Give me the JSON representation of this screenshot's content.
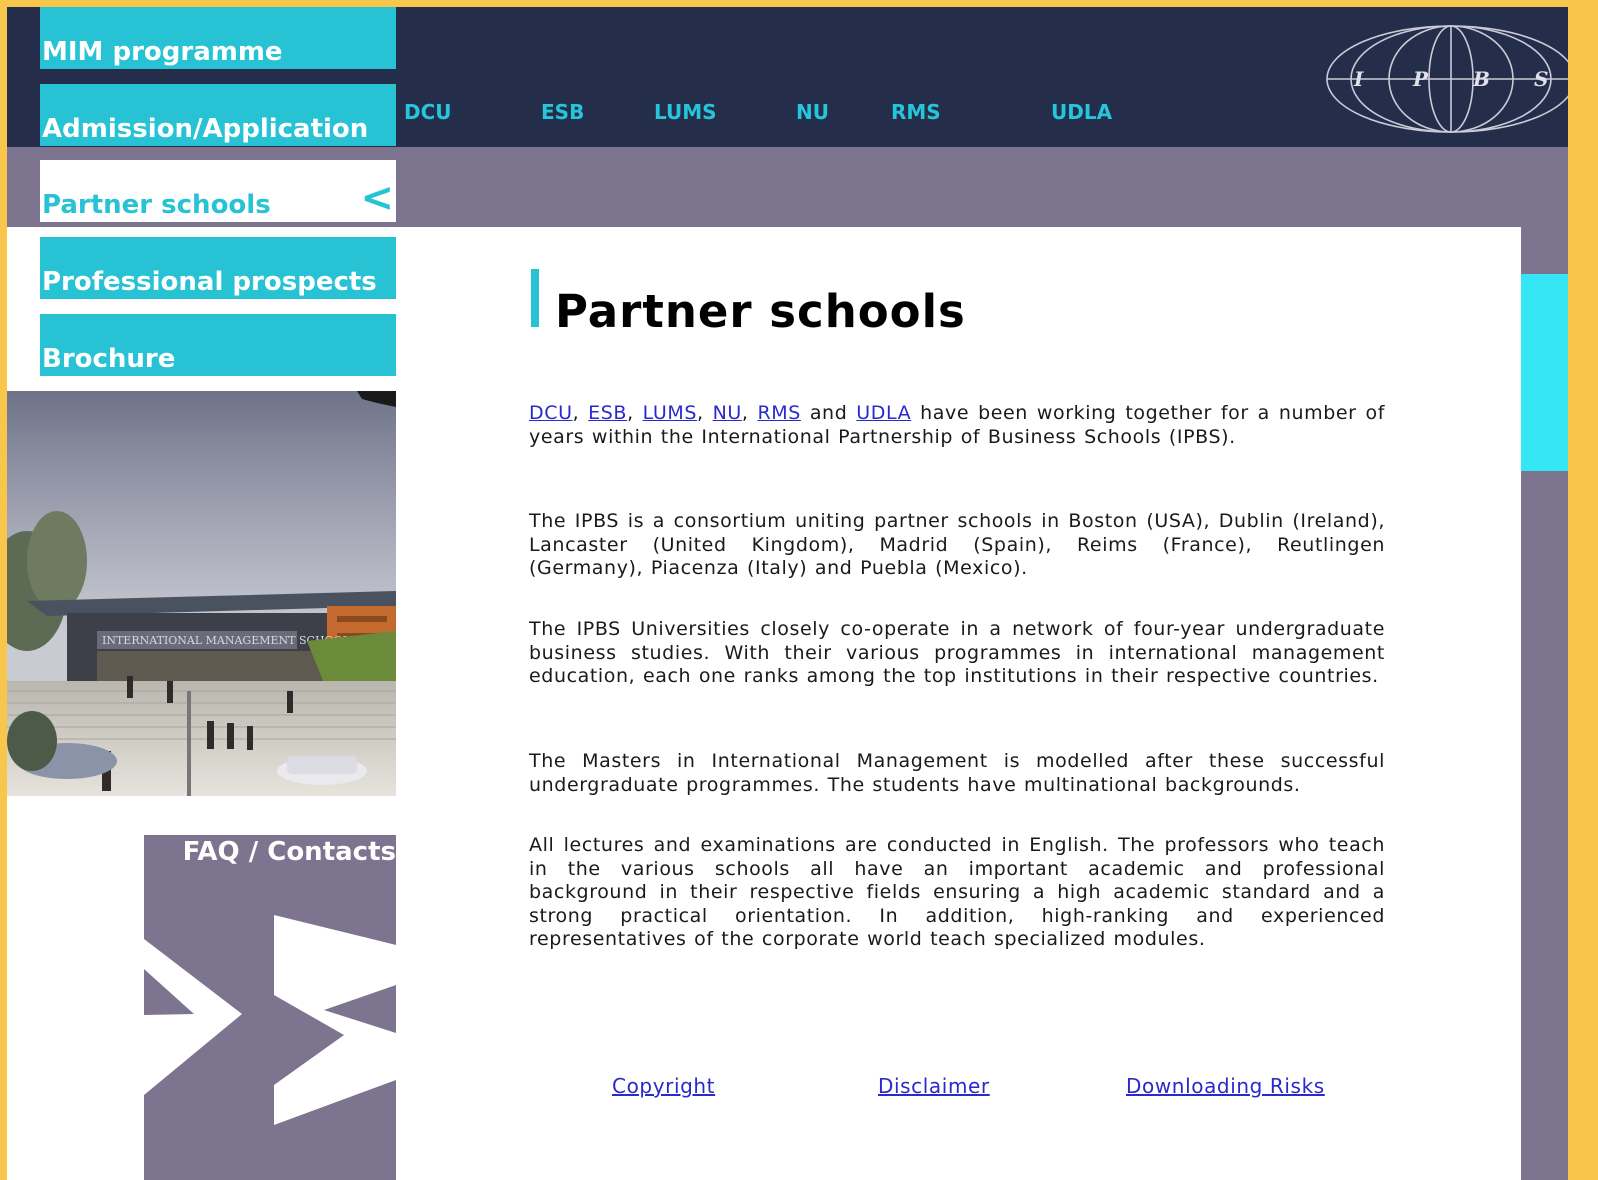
{
  "sidebar": {
    "items": [
      {
        "label": "MIM programme"
      },
      {
        "label": "Admission/Application"
      },
      {
        "label": "Partner schools",
        "active_indicator": "<"
      },
      {
        "label": "Professional prospects"
      },
      {
        "label": "Brochure"
      }
    ],
    "faq_label": "FAQ / Contacts",
    "campus_image_caption": "INTERNATIONAL MANAGEMENT SCHOOL"
  },
  "topnav": {
    "items": [
      {
        "label": "DCU"
      },
      {
        "label": "ESB"
      },
      {
        "label": "LUMS"
      },
      {
        "label": "NU"
      },
      {
        "label": "RMS"
      },
      {
        "label": "UDLA"
      }
    ]
  },
  "logo": {
    "letters": [
      "I",
      "P",
      "B",
      "S"
    ]
  },
  "main": {
    "title": "Partner schools",
    "intro_links": [
      "DCU",
      "ESB",
      "LUMS",
      "NU",
      "RMS",
      "UDLA"
    ],
    "intro_and": "and",
    "intro_rest": "have been working together for a number of years within the International Partnership of Business Schools (IPBS).",
    "paragraphs": [
      "The IPBS is a consortium uniting partner schools in Boston (USA), Dublin (Ireland), Lancaster (United Kingdom), Madrid (Spain), Reims (France), Reutlingen (Germany), Piacenza (Italy) and Puebla (Mexico).",
      "The IPBS Universities closely co-operate in a network of four-year undergraduate business studies. With their various programmes in international management education, each one ranks among the top institutions in their respective countries.",
      "The Masters in International Management is modelled after these successful undergraduate programmes. The students have multinational backgrounds.",
      "All lectures and examinations are conducted in English. The professors who teach in the various schools all have an important academic and professional background in their respective fields ensuring a high academic standard and a strong practical orientation. In addition, high-ranking and experienced representatives of the corporate world teach specialized modules."
    ]
  },
  "footer": {
    "copyright": "Copyright",
    "disclaimer": "Disclaimer",
    "downloading_risks": "Downloading Risks"
  },
  "colors": {
    "accent_cyan": "#27c3d4",
    "navy": "#242d4a",
    "purple_grey": "#7d7490",
    "bright_cyan": "#35e6f4",
    "link_blue": "#2a2acc",
    "page_border": "#f7c64a"
  }
}
